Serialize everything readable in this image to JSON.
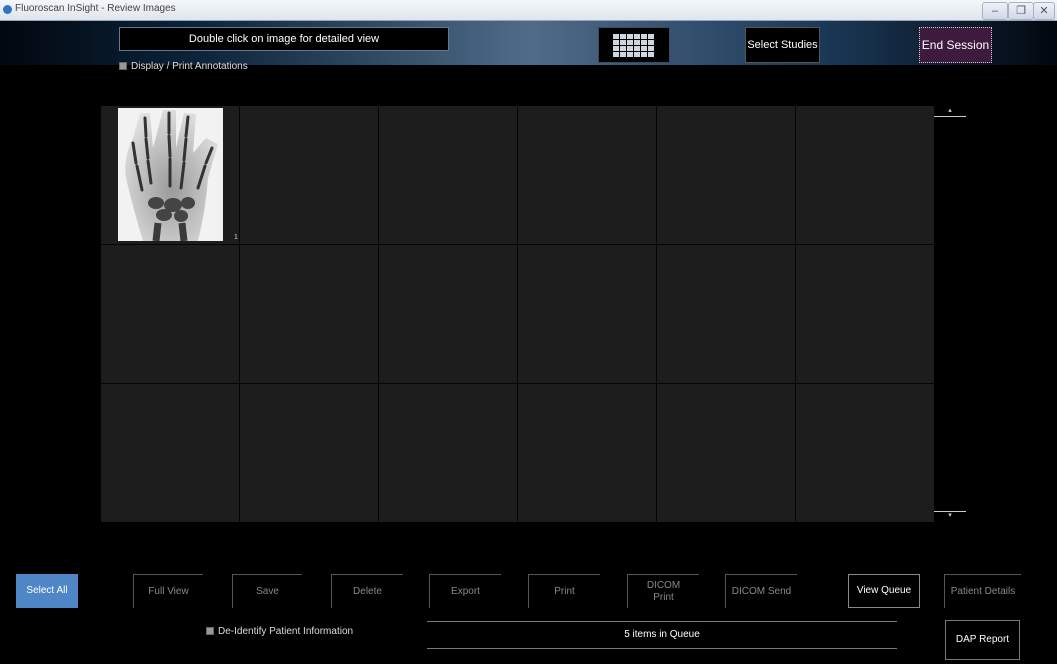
{
  "window": {
    "title": "Fluoroscan InSight - Review Images",
    "icon": "app-icon"
  },
  "header": {
    "instruction": "Double click on image for detailed view",
    "select_studies": "Select Studies",
    "end_session": "End Session",
    "layout_icon": "grid-layout-icon"
  },
  "options": {
    "annotations_label": "Display / Print Annotations",
    "deidentify_label": "De-Identify Patient Information"
  },
  "thumbnails": [
    {
      "index": "1",
      "type": "hand x-ray"
    }
  ],
  "buttons": {
    "select_all": "Select All",
    "full_view": "Full View",
    "save": "Save",
    "delete": "Delete",
    "export": "Export",
    "print": "Print",
    "dicom_print": "DICOM Print",
    "dicom_send": "DICOM Send",
    "view_queue": "View Queue",
    "patient_details": "Patient Details",
    "dap_report": "DAP Report"
  },
  "queue_status": "5 items in Queue",
  "colors": {
    "select_all_bg": "#4f86c6",
    "end_session_bg": "#3e1a3f"
  }
}
